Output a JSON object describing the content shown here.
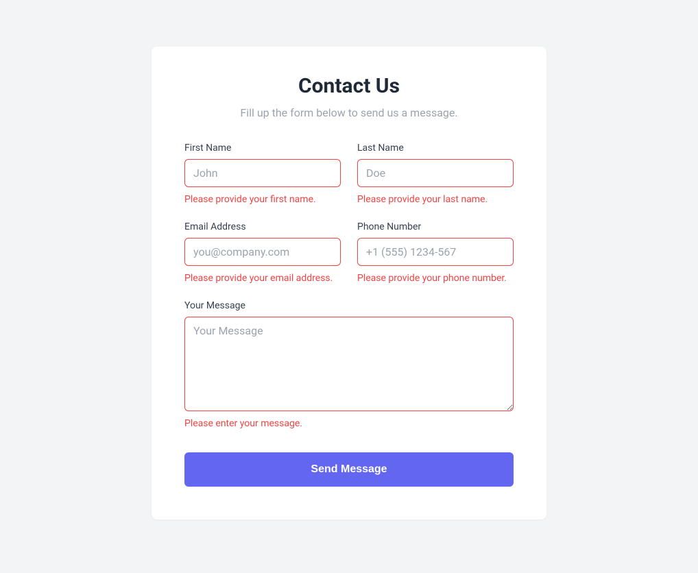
{
  "header": {
    "title": "Contact Us",
    "subtitle": "Fill up the form below to send us a message."
  },
  "fields": {
    "firstName": {
      "label": "First Name",
      "placeholder": "John",
      "value": "",
      "error": "Please provide your first name."
    },
    "lastName": {
      "label": "Last Name",
      "placeholder": "Doe",
      "value": "",
      "error": "Please provide your last name."
    },
    "email": {
      "label": "Email Address",
      "placeholder": "you@company.com",
      "value": "",
      "error": "Please provide your email address."
    },
    "phone": {
      "label": "Phone Number",
      "placeholder": "+1 (555) 1234-567",
      "value": "",
      "error": "Please provide your phone number."
    },
    "message": {
      "label": "Your Message",
      "placeholder": "Your Message",
      "value": "",
      "error": "Please enter your message."
    }
  },
  "submit": {
    "label": "Send Message"
  }
}
